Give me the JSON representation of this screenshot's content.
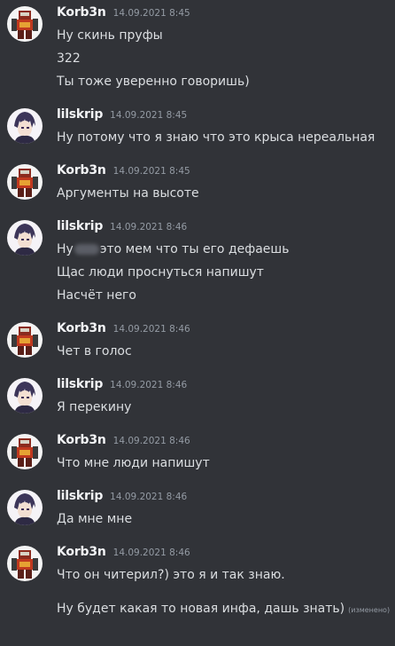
{
  "messages": [
    {
      "author": "Korb3n",
      "avatar": "robot-avatar",
      "time": "14.09.2021 8:45",
      "lines": [
        "Ну скинь пруфы",
        "322",
        "Ты тоже уверенно говоришь)"
      ]
    },
    {
      "author": "lilskrip",
      "avatar": "anime-boy-avatar",
      "time": "14.09.2021 8:45",
      "lines": [
        "Ну потому что я знаю что это крыса нереальная"
      ]
    },
    {
      "author": "Korb3n",
      "avatar": "robot-avatar",
      "time": "14.09.2021 8:45",
      "lines": [
        "Аргументы на высоте"
      ]
    },
    {
      "author": "lilskrip",
      "avatar": "anime-boy-avatar",
      "time": "14.09.2021 8:46",
      "first_prefix": "Ну",
      "first_suffix": "это мем что ты его дефаешь",
      "lines": [
        "Щас люди проснуться напишут",
        "Насчёт него"
      ]
    },
    {
      "author": "Korb3n",
      "avatar": "robot-avatar",
      "time": "14.09.2021 8:46",
      "lines": [
        "Чет в голос"
      ]
    },
    {
      "author": "lilskrip",
      "avatar": "anime-boy-avatar",
      "time": "14.09.2021 8:46",
      "lines": [
        "Я перекину"
      ]
    },
    {
      "author": "Korb3n",
      "avatar": "robot-avatar",
      "time": "14.09.2021 8:46",
      "lines": [
        "Что мне люди напишут"
      ]
    },
    {
      "author": "lilskrip",
      "avatar": "anime-boy-avatar",
      "time": "14.09.2021 8:46",
      "lines": [
        "Да мне мне"
      ]
    },
    {
      "author": "Korb3n",
      "avatar": "robot-avatar",
      "time": "14.09.2021 8:46",
      "lines": [
        "Что он читерил?) это я и так знаю.",
        "Ну будет какая то новая инфа, дашь знать)"
      ],
      "edited_label": "(изменено)"
    }
  ],
  "colors": {
    "background": "#313338",
    "username": "#f2f3f5",
    "text": "#dbdee1",
    "timestamp": "#949ba4"
  }
}
